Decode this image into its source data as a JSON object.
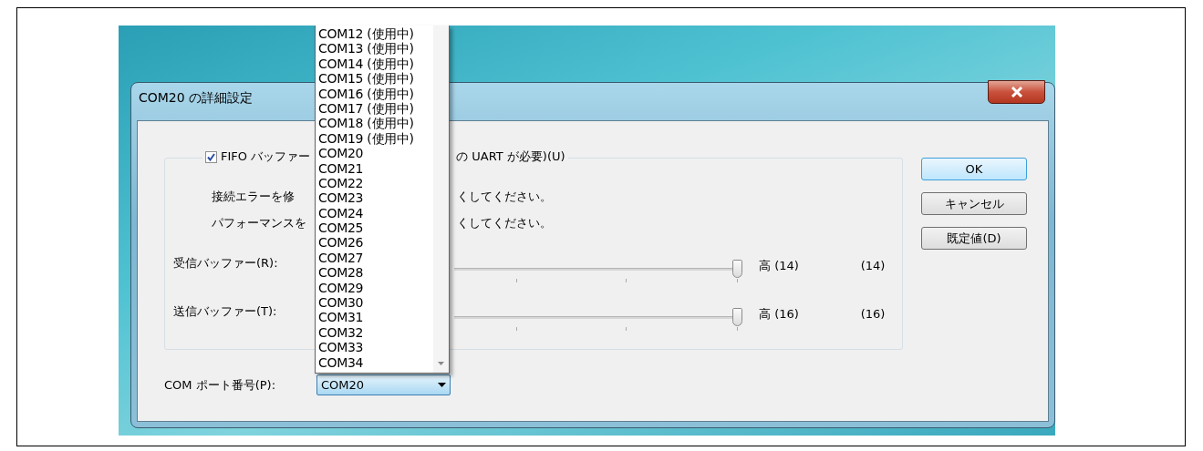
{
  "window": {
    "title": "COM20 の詳細設定"
  },
  "fifo": {
    "checked": true,
    "label_start": "FIFO バッファー",
    "label_end": "の UART が必要)(U)"
  },
  "notes": [
    {
      "start": "接続エラーを修",
      "end": "くしてください。"
    },
    {
      "start": "パフォーマンスを",
      "end": "くしてください。"
    }
  ],
  "buffers": [
    {
      "label": "受信バッファー(R):",
      "level": 1,
      "max_label": "高 (14)",
      "value": "(14)"
    },
    {
      "label": "送信バッファー(T):",
      "level": 1,
      "max_label": "高 (16)",
      "value": "(16)"
    }
  ],
  "buttons": [
    {
      "label": "OK",
      "default": true
    },
    {
      "label": "キャンセル",
      "default": false
    },
    {
      "label": "既定値(D)",
      "default": false
    }
  ],
  "port": {
    "label": "COM ポート番号(P):",
    "value": "COM20"
  },
  "port_list": [
    "COM12 (使用中)",
    "COM13 (使用中)",
    "COM14 (使用中)",
    "COM15 (使用中)",
    "COM16 (使用中)",
    "COM17 (使用中)",
    "COM18 (使用中)",
    "COM19 (使用中)",
    "COM20",
    "COM21",
    "COM22",
    "COM23",
    "COM24",
    "COM25",
    "COM26",
    "COM27",
    "COM28",
    "COM29",
    "COM30",
    "COM31",
    "COM32",
    "COM33",
    "COM34"
  ]
}
